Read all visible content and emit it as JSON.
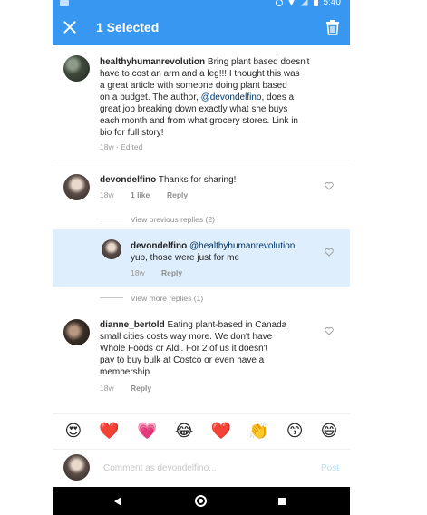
{
  "status_bar": {
    "time": "5:40"
  },
  "app_bar": {
    "title": "1 Selected"
  },
  "caption": {
    "username": "healthyhumanrevolution",
    "lines": [
      {
        "pre": "",
        "text": "Bring plant based doesn't"
      },
      {
        "pre": "",
        "text": "have to cost an arm and a leg!!! I thought this was"
      },
      {
        "pre": "",
        "text": "a great article with someone doing plant based"
      },
      {
        "pre": "",
        "text": "on a budget.  The author,"
      }
    ],
    "mention": "@devondelfino",
    "line4_post": ", does a",
    "rest_lines": [
      "great job breaking down exactly what she buys",
      "each month and from what grocery stores.  Link in",
      "bio for full story!"
    ],
    "meta": "18w · Edited"
  },
  "comments": [
    {
      "username": "devondelfino",
      "text": "Thanks for sharing!",
      "time": "18w",
      "likes": "1 like",
      "reply": "Reply"
    }
  ],
  "view_previous": "View previous replies (2)",
  "selected_reply": {
    "username": "devondelfino",
    "mention": "@healthyhumanrevolution",
    "text2": "yup,  those were just for me",
    "time": "18w",
    "reply": "Reply"
  },
  "view_more": "View more replies (1)",
  "comment3": {
    "username": "dianne_bertold",
    "line1": "Eating plant-based in Canada",
    "lines": [
      "small cities costs way more. We don't have",
      "Whole Foods or Aldi.  For 2 of us it doesn't",
      "pay to buy bulk at Costco or even have a",
      "membership."
    ],
    "time": "18w",
    "reply": "Reply"
  },
  "emoji_bar": [
    "😍",
    "❤️",
    "💗",
    "😂",
    "❤️",
    "👏",
    "😙",
    "😄"
  ],
  "comment_input": {
    "placeholder": "Comment as devondelfino...",
    "post": "Post"
  },
  "colors": {
    "accent": "#3897f0",
    "highlight": "#deeefc",
    "mention": "#003569"
  }
}
